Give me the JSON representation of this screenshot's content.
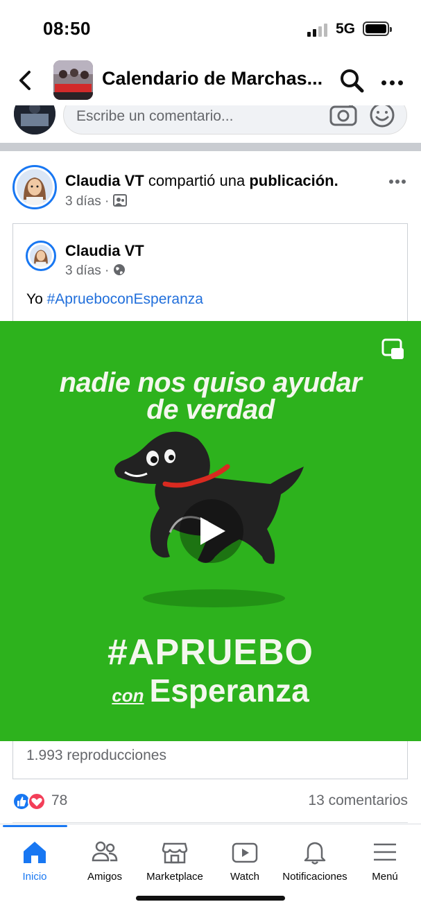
{
  "status": {
    "time": "08:50",
    "network": "5G"
  },
  "header": {
    "title": "Calendario de Marchas...",
    "group_image_text": "MERA HUELE A DIGNIDAD"
  },
  "comment_box": {
    "placeholder": "Escribe un comentario..."
  },
  "post": {
    "author": "Claudia VT",
    "action_text": "compartió una",
    "object_text": "publicación.",
    "time": "3 días",
    "privacy_icon": "group-icon"
  },
  "shared": {
    "author": "Claudia VT",
    "time": "3 días",
    "privacy_icon": "globe-icon",
    "text_prefix": "Yo",
    "hashtag": "#AprueboconEsperanza"
  },
  "video": {
    "line1": "nadie nos quiso ayudar",
    "line2": "de verdad",
    "hashtag_line1": "#APRUEBO",
    "hashtag_con": "con",
    "hashtag_line2": "Esperanza",
    "background_color": "#2db21d"
  },
  "views": "1.993 reproducciones",
  "reactions": {
    "count": "78",
    "comments": "13 comentarios"
  },
  "tabs": [
    {
      "label": "Inicio",
      "active": true
    },
    {
      "label": "Amigos",
      "active": false
    },
    {
      "label": "Marketplace",
      "active": false
    },
    {
      "label": "Watch",
      "active": false
    },
    {
      "label": "Notificaciones",
      "active": false
    },
    {
      "label": "Menú",
      "active": false
    }
  ]
}
